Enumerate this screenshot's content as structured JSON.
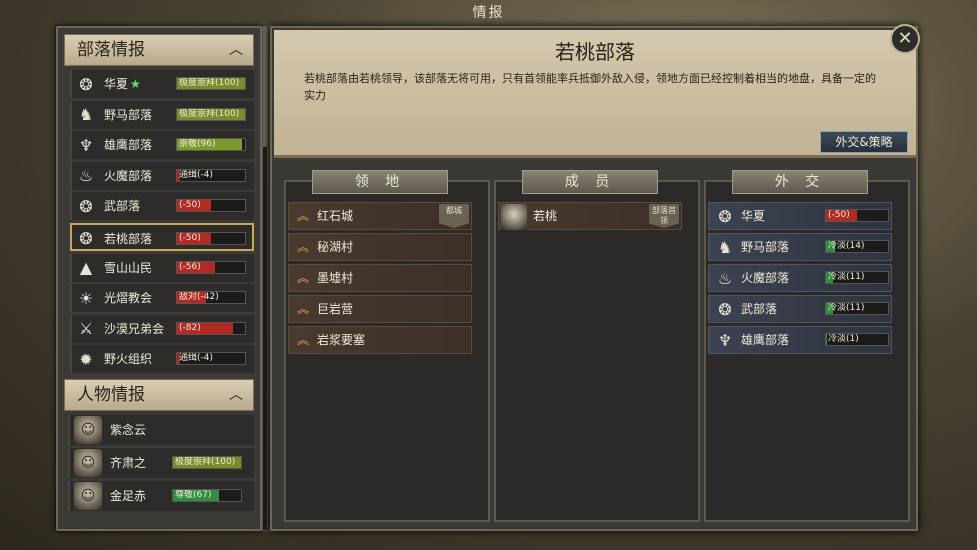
{
  "window": {
    "title": "情报"
  },
  "tribe_section": {
    "title": "部落情报",
    "items": [
      {
        "name": "华夏",
        "star": "★",
        "relation": "极度崇拜(100)",
        "ratio": 1.0,
        "color": "#7c8a2a",
        "icon": "clan-crest-icon"
      },
      {
        "name": "野马部落",
        "star": "",
        "relation": "极度崇拜(100)",
        "ratio": 1.0,
        "color": "#7c8a2a",
        "icon": "horse-crest-icon"
      },
      {
        "name": "雄鹰部落",
        "star": "",
        "relation": "崇敬(96)",
        "ratio": 0.96,
        "color": "#7c9a2e",
        "icon": "eagle-crest-icon"
      },
      {
        "name": "火魔部落",
        "star": "",
        "relation": "通缉(-4)",
        "ratio": 0.04,
        "color": "#9a2a22",
        "icon": "fire-crest-icon"
      },
      {
        "name": "武部落",
        "star": "",
        "relation": "(-50)",
        "ratio": 0.5,
        "color": "#b22a24",
        "icon": "clan-crest-icon"
      },
      {
        "name": "若桃部落",
        "star": "",
        "relation": "(-50)",
        "ratio": 0.5,
        "color": "#b22a24",
        "icon": "clan-crest-icon",
        "selected": true
      },
      {
        "name": "雪山山民",
        "star": "",
        "relation": "(-56)",
        "ratio": 0.56,
        "color": "#b22a24",
        "icon": "mountain-crest-icon"
      },
      {
        "name": "光熠教会",
        "star": "",
        "relation": "敌对(-42)",
        "ratio": 0.42,
        "color": "#b22a24",
        "icon": "sun-crest-icon"
      },
      {
        "name": "沙漠兄弟会",
        "star": "",
        "relation": "(-82)",
        "ratio": 0.82,
        "color": "#b22a24",
        "icon": "swords-crest-icon"
      },
      {
        "name": "野火组织",
        "star": "",
        "relation": "通缉(-4)",
        "ratio": 0.04,
        "color": "#9a2a22",
        "icon": "flame-crest-icon"
      }
    ]
  },
  "character_section": {
    "title": "人物情报",
    "items": [
      {
        "name": "紫念云",
        "relation": "",
        "ratio": 0,
        "color": "#000000"
      },
      {
        "name": "齐肃之",
        "relation": "极度崇拜(100)",
        "ratio": 1.0,
        "color": "#7c8a2a"
      },
      {
        "name": "金足赤",
        "relation": "尊敬(67)",
        "ratio": 0.67,
        "color": "#2f8f3f"
      }
    ]
  },
  "detail": {
    "title": "若桃部落",
    "description": "若桃部落由若桃领导，该部落无将可用，只有首领能率兵抵御外敌入侵，领地方面已经控制着相当的地盘，具备一定的实力",
    "diplomacy_button": "外交&策略",
    "territory": {
      "header": "领 地",
      "items": [
        {
          "name": "红石城",
          "tag": "都城"
        },
        {
          "name": "秘湖村",
          "tag": ""
        },
        {
          "name": "墨墟村",
          "tag": ""
        },
        {
          "name": "巨岩营",
          "tag": ""
        },
        {
          "name": "岩浆要塞",
          "tag": ""
        }
      ]
    },
    "members": {
      "header": "成 员",
      "items": [
        {
          "name": "若桃",
          "tag": "部落首领"
        }
      ]
    },
    "diplomacy": {
      "header": "外 交",
      "items": [
        {
          "name": "华夏",
          "relation": "(-50)",
          "ratio": 0.5,
          "color": "#b22a24"
        },
        {
          "name": "野马部落",
          "relation": "冷淡(14)",
          "ratio": 0.14,
          "color": "#2f8f3f"
        },
        {
          "name": "火魔部落",
          "relation": "冷淡(11)",
          "ratio": 0.11,
          "color": "#2f8f3f"
        },
        {
          "name": "武部落",
          "relation": "冷淡(11)",
          "ratio": 0.11,
          "color": "#2f8f3f"
        },
        {
          "name": "雄鹰部落",
          "relation": "冷淡(1)",
          "ratio": 0.01,
          "color": "#2f8f3f"
        }
      ]
    }
  }
}
